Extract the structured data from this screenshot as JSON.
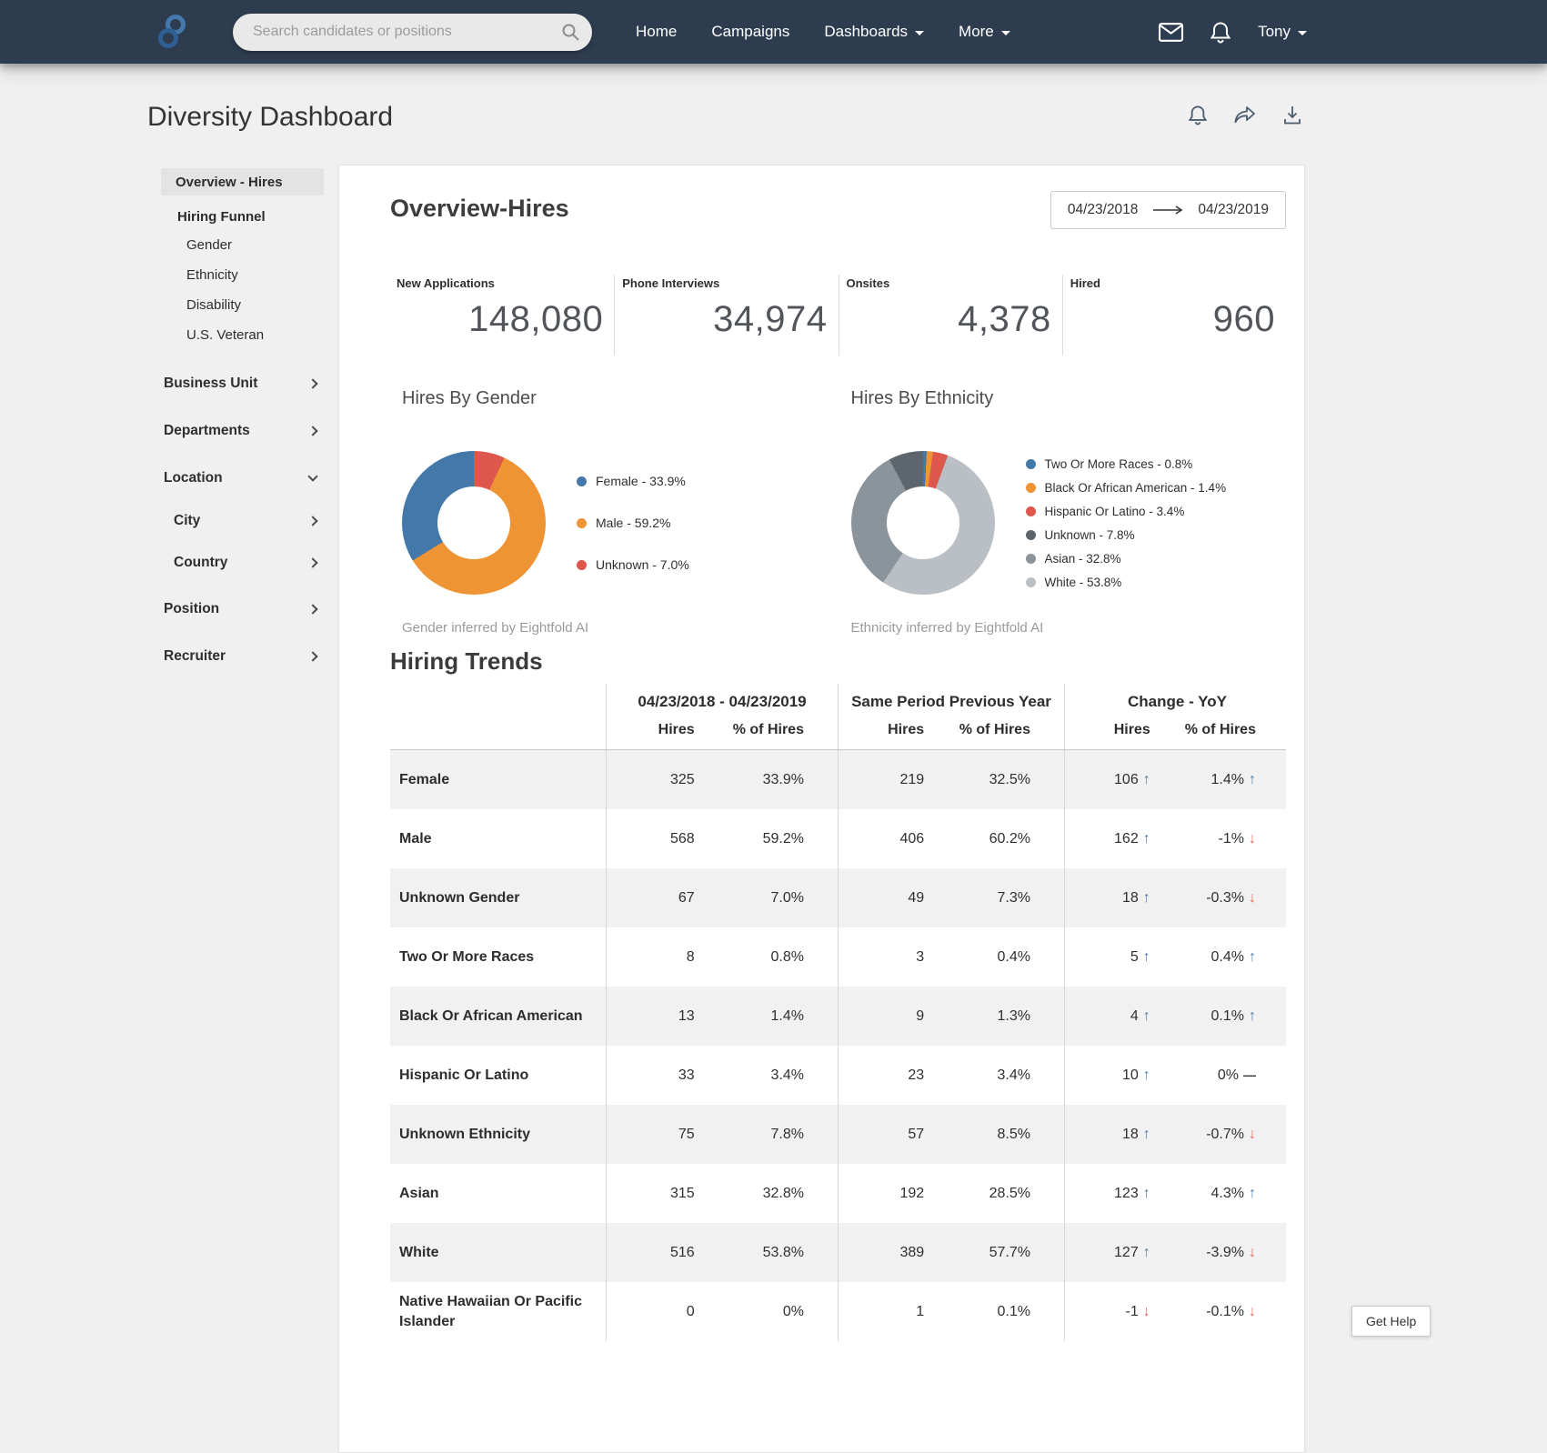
{
  "navbar": {
    "search": {
      "placeholder": "Search candidates or positions"
    },
    "links": [
      "Home",
      "Campaigns",
      "Dashboards",
      "More"
    ],
    "user": {
      "name": "Tony"
    }
  },
  "page": {
    "title": "Diversity Dashboard"
  },
  "sidebar": {
    "overview": "Overview - Hires",
    "hiring_funnel": "Hiring Funnel",
    "gender": "Gender",
    "ethnicity": "Ethnicity",
    "disability": "Disability",
    "veteran": "U.S. Veteran",
    "business_unit": "Business Unit",
    "departments": "Departments",
    "location": "Location",
    "city": "City",
    "country": "Country",
    "position": "Position",
    "recruiter": "Recruiter"
  },
  "overview": {
    "heading": "Overview-Hires",
    "date_from": "04/23/2018",
    "date_to": "04/23/2019",
    "stats": [
      {
        "label": "New Applications",
        "value": "148,080"
      },
      {
        "label": "Phone Interviews",
        "value": "34,974"
      },
      {
        "label": "Onsites",
        "value": "4,378"
      },
      {
        "label": "Hired",
        "value": "960"
      }
    ]
  },
  "chart_data": [
    {
      "type": "pie",
      "title": "Hires By Gender",
      "footnote": "Gender inferred by Eightfold AI",
      "legend_position": "right",
      "legend": [
        {
          "label": "Female - 33.9%",
          "color": "#4478a9"
        },
        {
          "label": "Male - 59.2%",
          "color": "#ee9434"
        },
        {
          "label": "Unknown - 7.0%",
          "color": "#dd574d"
        }
      ],
      "segments": [
        {
          "name": "Unknown",
          "value": 7.0,
          "color": "#dd574d"
        },
        {
          "name": "Male",
          "value": 59.2,
          "color": "#ee9434"
        },
        {
          "name": "Female",
          "value": 33.9,
          "color": "#4478a9"
        }
      ]
    },
    {
      "type": "pie",
      "title": "Hires By Ethnicity",
      "footnote": "Ethnicity inferred by Eightfold AI",
      "legend_position": "right",
      "legend": [
        {
          "label": "Two Or More Races - 0.8%",
          "color": "#4478a9"
        },
        {
          "label": "Black Or African American - 1.4%",
          "color": "#ee9434"
        },
        {
          "label": "Hispanic Or Latino - 3.4%",
          "color": "#dd574d"
        },
        {
          "label": "Unknown - 7.8%",
          "color": "#5d666d"
        },
        {
          "label": "Asian - 32.8%",
          "color": "#8b939b"
        },
        {
          "label": "White - 53.8%",
          "color": "#b9bfc4"
        }
      ],
      "segments": [
        {
          "name": "Two Or More Races",
          "value": 0.8,
          "color": "#4478a9"
        },
        {
          "name": "Black Or African American",
          "value": 1.4,
          "color": "#ee9434"
        },
        {
          "name": "Hispanic Or Latino",
          "value": 3.4,
          "color": "#dd574d"
        },
        {
          "name": "White",
          "value": 53.8,
          "color": "#b9bfc4"
        },
        {
          "name": "Asian",
          "value": 32.8,
          "color": "#8b939b"
        },
        {
          "name": "Unknown",
          "value": 7.8,
          "color": "#5d666d"
        }
      ]
    }
  ],
  "trends": {
    "heading": "Hiring Trends",
    "col_groups": [
      "04/23/2018 - 04/23/2019",
      "Same Period Previous Year",
      "Change - YoY"
    ],
    "sub_cols": [
      "Hires",
      "% of Hires"
    ],
    "rows": [
      {
        "label": "Female",
        "hires": "325",
        "pct": "33.9%",
        "prev_hires": "219",
        "prev_pct": "32.5%",
        "chg_hires": "106",
        "chg_hires_dir": "up",
        "chg_pct": "1.4%",
        "chg_pct_dir": "up"
      },
      {
        "label": "Male",
        "hires": "568",
        "pct": "59.2%",
        "prev_hires": "406",
        "prev_pct": "60.2%",
        "chg_hires": "162",
        "chg_hires_dir": "up",
        "chg_pct": "-1%",
        "chg_pct_dir": "down"
      },
      {
        "label": "Unknown Gender",
        "hires": "67",
        "pct": "7.0%",
        "prev_hires": "49",
        "prev_pct": "7.3%",
        "chg_hires": "18",
        "chg_hires_dir": "up",
        "chg_pct": "-0.3%",
        "chg_pct_dir": "down"
      },
      {
        "label": "Two Or More Races",
        "hires": "8",
        "pct": "0.8%",
        "prev_hires": "3",
        "prev_pct": "0.4%",
        "chg_hires": "5",
        "chg_hires_dir": "up",
        "chg_pct": "0.4%",
        "chg_pct_dir": "up"
      },
      {
        "label": "Black Or African American",
        "hires": "13",
        "pct": "1.4%",
        "prev_hires": "9",
        "prev_pct": "1.3%",
        "chg_hires": "4",
        "chg_hires_dir": "up",
        "chg_pct": "0.1%",
        "chg_pct_dir": "up"
      },
      {
        "label": "Hispanic Or Latino",
        "hires": "33",
        "pct": "3.4%",
        "prev_hires": "23",
        "prev_pct": "3.4%",
        "chg_hires": "10",
        "chg_hires_dir": "up",
        "chg_pct": "0%",
        "chg_pct_dir": "dash"
      },
      {
        "label": "Unknown Ethnicity",
        "hires": "75",
        "pct": "7.8%",
        "prev_hires": "57",
        "prev_pct": "8.5%",
        "chg_hires": "18",
        "chg_hires_dir": "up",
        "chg_pct": "-0.7%",
        "chg_pct_dir": "down"
      },
      {
        "label": "Asian",
        "hires": "315",
        "pct": "32.8%",
        "prev_hires": "192",
        "prev_pct": "28.5%",
        "chg_hires": "123",
        "chg_hires_dir": "up",
        "chg_pct": "4.3%",
        "chg_pct_dir": "up"
      },
      {
        "label": "White",
        "hires": "516",
        "pct": "53.8%",
        "prev_hires": "389",
        "prev_pct": "57.7%",
        "chg_hires": "127",
        "chg_hires_dir": "up",
        "chg_pct": "-3.9%",
        "chg_pct_dir": "down"
      },
      {
        "label": "Native Hawaiian Or Pacific Islander",
        "hires": "0",
        "pct": "0%",
        "prev_hires": "1",
        "prev_pct": "0.1%",
        "chg_hires": "-1",
        "chg_hires_dir": "down",
        "chg_pct": "-0.1%",
        "chg_pct_dir": "down"
      }
    ]
  },
  "help": {
    "label": "Get Help"
  }
}
